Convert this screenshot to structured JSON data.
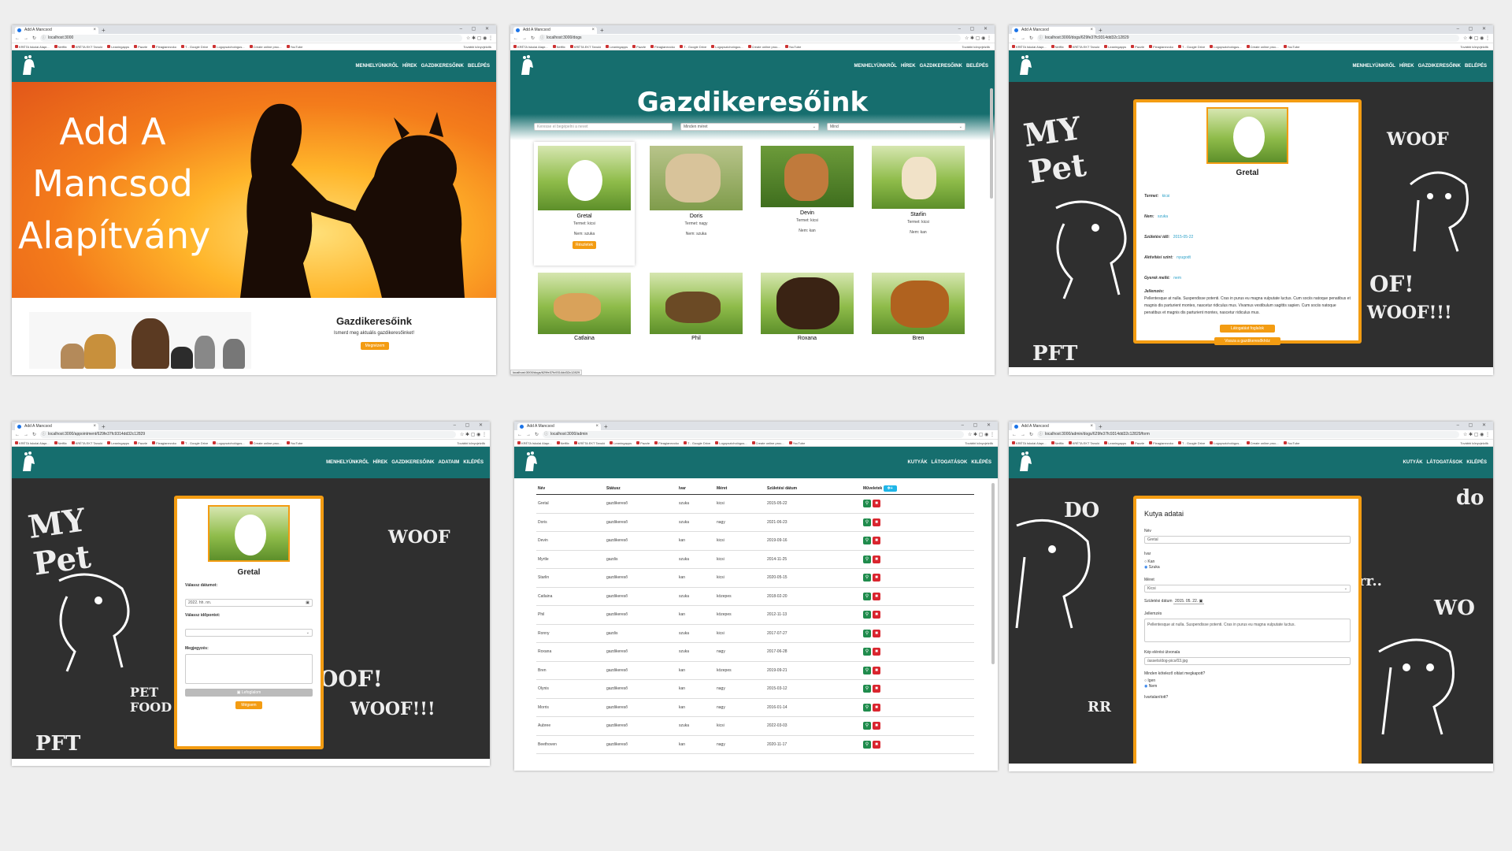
{
  "browser": {
    "tab_title": "Add A Mancsod",
    "bookmarks": [
      "KRÉTA Iskolai Alapr...",
      "Netflix",
      "KRÉTA EKT Tanuló",
      "Leaningapps",
      "Pazzle",
      "Fleagianezcko",
      "T - Google Drive",
      "Logopszichológus...",
      "Create online proc...",
      "YouTube"
    ],
    "other_bookmarks": "További könyvjelzők"
  },
  "nav": {
    "public": [
      "MENHELYÜNKRŐL",
      "HÍREK",
      "GAZDIKERESŐINK",
      "BELÉPÉS"
    ],
    "user": [
      "MENHELYÜNKRŐL",
      "HÍREK",
      "GAZDIKERESŐINK",
      "ADATAIM",
      "KILÉPÉS"
    ],
    "admin": [
      "KUTYÁK",
      "LÁTOGATÁSOK",
      "KILÉPÉS"
    ]
  },
  "shot1": {
    "url": "localhost:3000",
    "hero_line1": "Add A",
    "hero_line2": "Mancsod",
    "hero_line3": "Alapítvány",
    "section_title": "Gazdikeresőink",
    "section_text": "Ismerd meg aktuális gazdikeresőinket!",
    "section_button": "Megnézem"
  },
  "shot2": {
    "url": "localhost:3000/dogs",
    "title": "Gazdikeresőink",
    "search_placeholder": "Keresse el begépelni a nevet",
    "size_filter": "Minden méret",
    "gender_filter": "Mind",
    "status_bar": "localhost:3000/dogs/629fe37fc9314dd32c12829",
    "cards": [
      {
        "name": "Gretal",
        "size": "Termet: kicsi",
        "gender": "Nem: szuka",
        "button": "Részletek"
      },
      {
        "name": "Doris",
        "size": "Termet: nagy",
        "gender": "Nem: szuka"
      },
      {
        "name": "Devin",
        "size": "Termet: kicsi",
        "gender": "Nem: kan"
      },
      {
        "name": "Starlin",
        "size": "Termet: kicsi",
        "gender": "Nem: kan"
      },
      {
        "name": "Catlaina"
      },
      {
        "name": "Phil",
        "size": "Termet: közepes"
      },
      {
        "name": "Roxana",
        "size": "Termet: nagy"
      },
      {
        "name": "Bren",
        "size": "Termet: közepes"
      }
    ]
  },
  "shot3": {
    "url": "localhost:3000/dogs/629fe37fc9314dd32c12829",
    "name": "Gretal",
    "fields": [
      {
        "label": "Termet:",
        "value": "kicsi"
      },
      {
        "label": "Nem:",
        "value": "szuka"
      },
      {
        "label": "Születési idő:",
        "value": "2015-05-22"
      },
      {
        "label": "Aktivitási szint:",
        "value": "nyugodt"
      },
      {
        "label": "Gyerek mellé:",
        "value": "nem"
      }
    ],
    "desc_label": "Jellemzés:",
    "desc": "Pellentesque at nulla. Suspendisse potenti. Cras in purus eu magna vulputate luctus. Cum sociis natoque penatibus et magnis dis parturient montes, nascetur ridiculus mus. Vivamus vestibulum sagittis sapien. Cum sociis natoque penatibus et magnis dis parturient montes, nascetur ridiculus mus.",
    "btn_visit": "Látogatást foglalok",
    "btn_back": "Vissza a gazdikeresőkhöz"
  },
  "shot4": {
    "url": "localhost:3000/appointment/629fe37fc9314dd32c12829",
    "name": "Gretal",
    "date_label": "Válassz dátumot:",
    "date_value": "2022. hh. nn.",
    "time_label": "Válassz időpontot:",
    "note_label": "Megjegyzés:",
    "btn_book": "Lefoglalom",
    "btn_back": "Mégsem"
  },
  "shot5": {
    "url": "localhost:3000/admin",
    "headers": [
      "Név",
      "Státusz",
      "Ivar",
      "Méret",
      "Születési dátum",
      "Műveletek"
    ],
    "add_button": "+",
    "rows": [
      [
        "Gretal",
        "gazdikereső",
        "szuka",
        "kicsi",
        "2015-05-22"
      ],
      [
        "Doris",
        "gazdikereső",
        "szuka",
        "nagy",
        "2021-06-23"
      ],
      [
        "Devin",
        "gazdikereső",
        "kan",
        "kicsi",
        "2019-09-16"
      ],
      [
        "Myrtle",
        "gazdis",
        "szuka",
        "kicsi",
        "2014-11-25"
      ],
      [
        "Starlin",
        "gazdikereső",
        "kan",
        "kicsi",
        "2020-05-15"
      ],
      [
        "Catlaina",
        "gazdikereső",
        "szuka",
        "közepes",
        "2018-02-20"
      ],
      [
        "Phil",
        "gazdikereső",
        "kan",
        "közepes",
        "2012-11-13"
      ],
      [
        "Ronny",
        "gazdis",
        "szuka",
        "kicsi",
        "2017-07-27"
      ],
      [
        "Roxana",
        "gazdikereső",
        "szuka",
        "nagy",
        "2017-06-28"
      ],
      [
        "Bren",
        "gazdikereső",
        "kan",
        "közepes",
        "2019-09-21"
      ],
      [
        "Olynis",
        "gazdikereső",
        "kan",
        "nagy",
        "2015-03-12"
      ],
      [
        "Morris",
        "gazdikereső",
        "kan",
        "nagy",
        "2016-01-14"
      ],
      [
        "Aubree",
        "gazdikereső",
        "szuka",
        "kicsi",
        "2022-03-03"
      ],
      [
        "Beethoven",
        "gazdikereső",
        "kan",
        "nagy",
        "2020-11-17"
      ]
    ]
  },
  "shot6": {
    "url": "localhost:3000/admin/dogs/629fe37fc9314dd32c12829/form",
    "title": "Kutya adatai",
    "name_label": "Név",
    "name_value": "Gretal",
    "gender_label": "Ivar",
    "gender_opt1": "Kan",
    "gender_opt2": "Szuka",
    "size_label": "Méret",
    "size_value": "Kicsi",
    "birth_label": "Születési dátum",
    "birth_value": "2015. 05. 22.",
    "desc_label": "Jellemzés",
    "desc_value": "Pellentesque at nulla. Suspendisse potenti. Cras in purus eu magna vulputate luctus.",
    "img_label": "Kép elérési útvonala",
    "img_value": "/assets/dog-pics/03.jpg",
    "vacc_label": "Minden kötelező oltást megkapott?",
    "yes": "Igen",
    "no": "Nem",
    "last_label": "Ivartalanított?"
  },
  "colors": {
    "teal": "#166e6e",
    "orange": "#f39c12",
    "dark": "#2f2f2f"
  }
}
